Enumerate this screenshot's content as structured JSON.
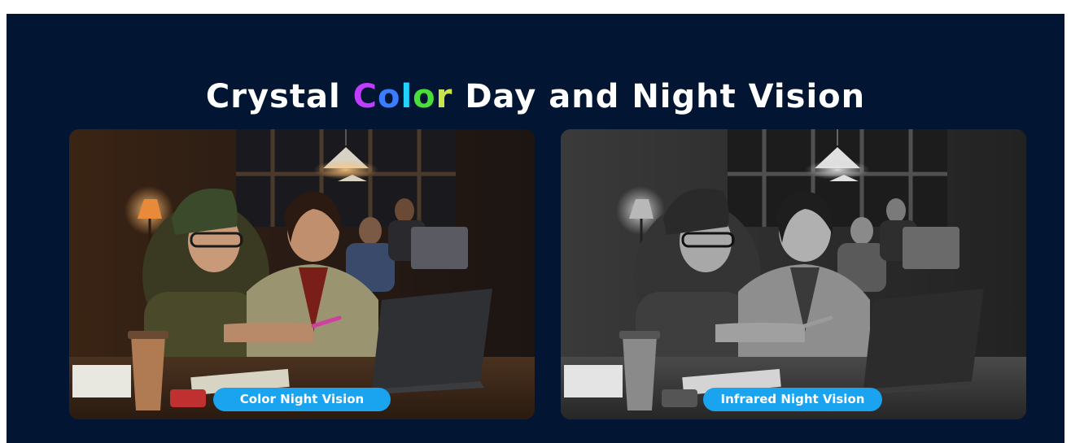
{
  "header": {
    "title_before": "Crystal",
    "title_highlight": [
      "C",
      "o",
      "l",
      "o",
      "r"
    ],
    "title_after": "Day and Night Vision",
    "highlight_colors": [
      "#c03cff",
      "#3b7dff",
      "#22d3ff",
      "#4ade3a",
      "#c8e64a"
    ]
  },
  "panels": [
    {
      "label": "Color Night Vision",
      "mode": "color"
    },
    {
      "label": "Infrared Night Vision",
      "mode": "grayscale"
    }
  ],
  "colors": {
    "background": "#021532",
    "pill": "#1aa3ee"
  }
}
